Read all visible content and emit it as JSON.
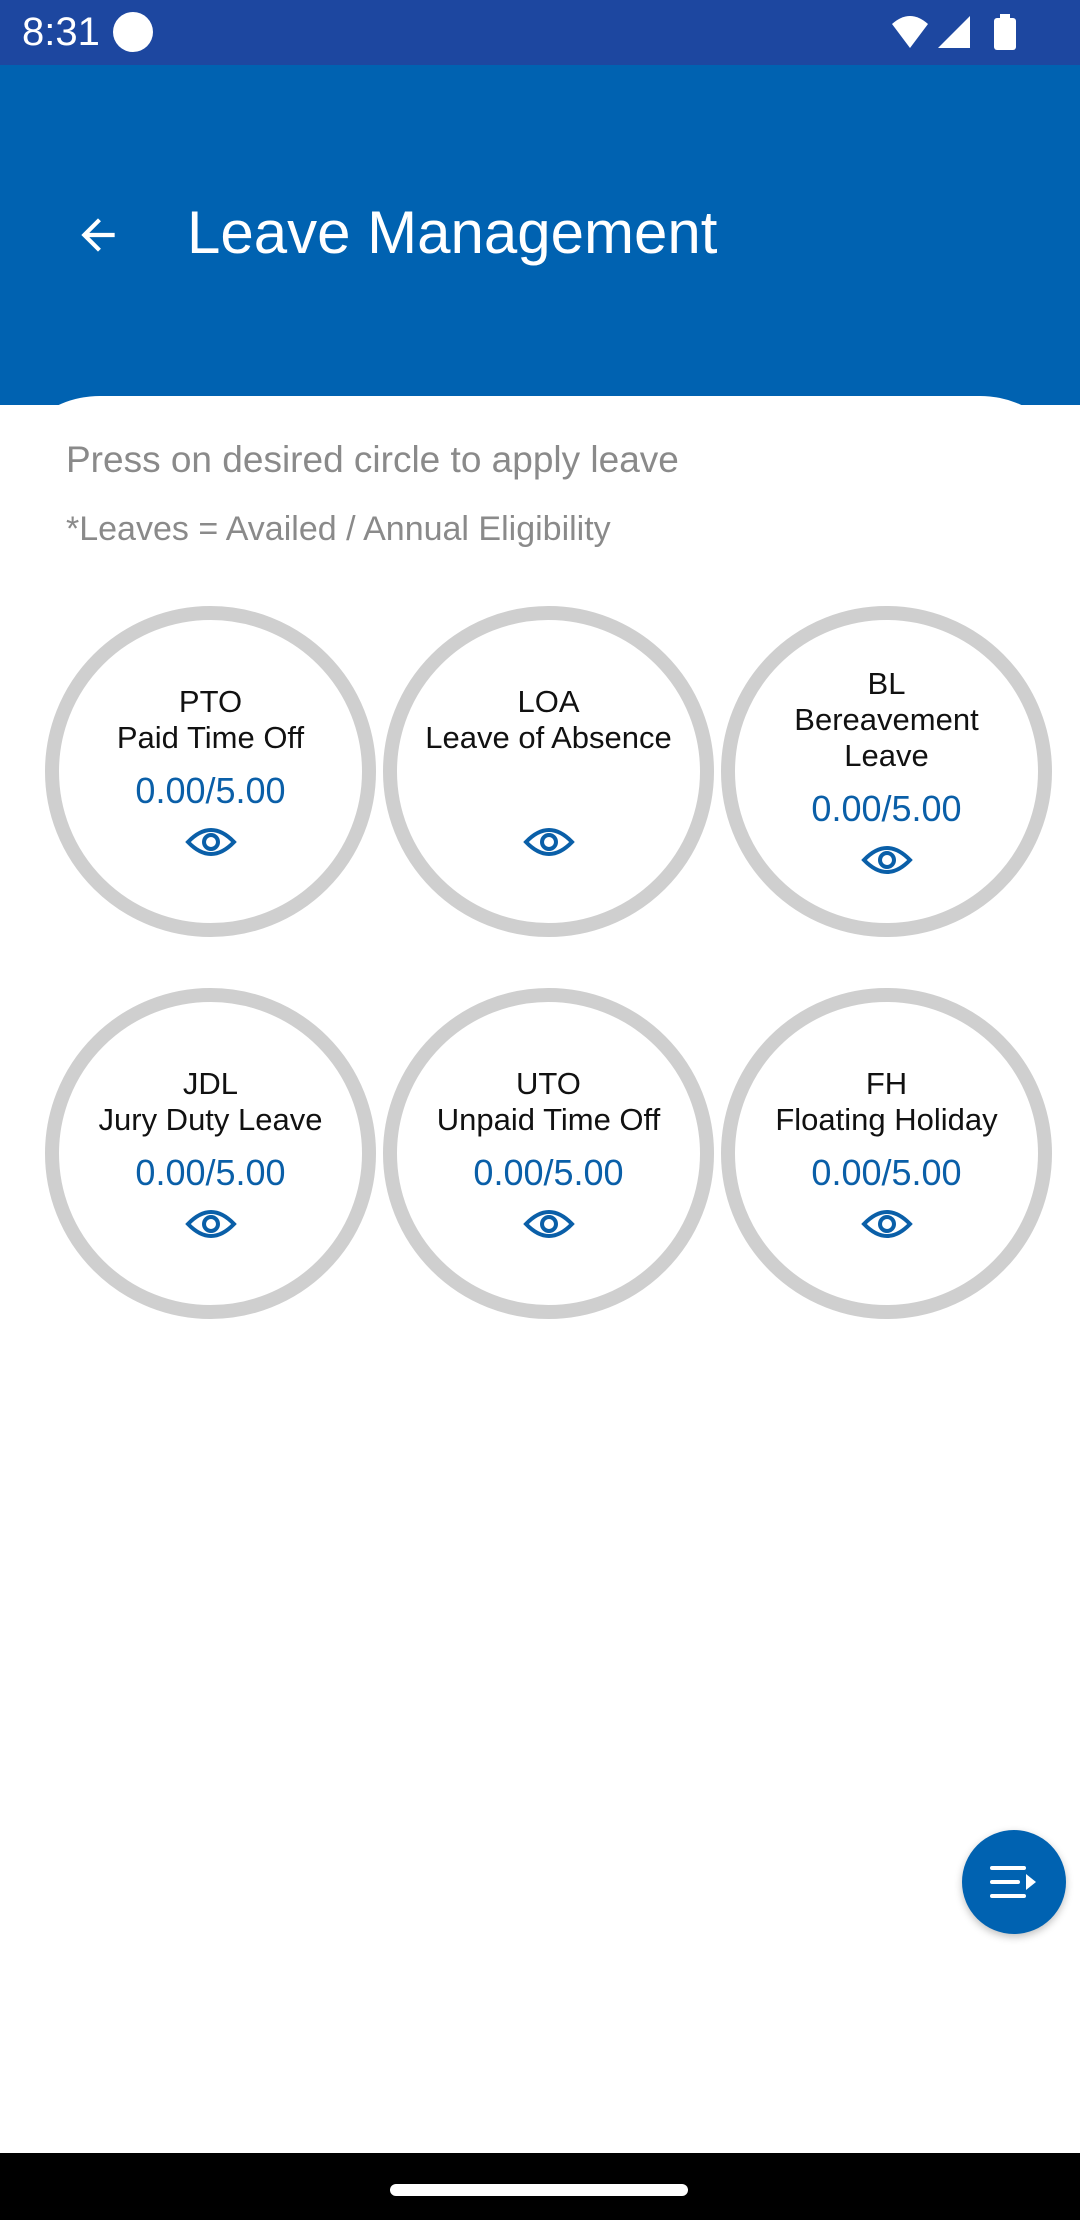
{
  "status_bar": {
    "time": "8:31",
    "icons": [
      "notification-dot-icon",
      "wifi-icon",
      "signal-icon",
      "battery-icon"
    ]
  },
  "header": {
    "title": "Leave Management",
    "back_icon": "arrow-left-icon"
  },
  "instructions": {
    "hint": "Press on desired circle to apply leave",
    "legend": "*Leaves = Availed / Annual Eligibility"
  },
  "leave_types": [
    {
      "code": "PTO",
      "name": "Paid Time Off",
      "value": "0.00/5.00"
    },
    {
      "code": "LOA",
      "name": "Leave of Absence",
      "value": ""
    },
    {
      "code": "BL",
      "name": "Bereavement Leave",
      "value": "0.00/5.00"
    },
    {
      "code": "JDL",
      "name": "Jury Duty Leave",
      "value": "0.00/5.00"
    },
    {
      "code": "UTO",
      "name": "Unpaid Time Off",
      "value": "0.00/5.00"
    },
    {
      "code": "FH",
      "name": "Floating Holiday",
      "value": "0.00/5.00"
    }
  ],
  "fab": {
    "icon": "menu-expand-icon"
  },
  "colors": {
    "status_bar": "#1d47a0",
    "app_bar": "#0062b1",
    "accent": "#0a5fa8",
    "circle_ring": "#cfcfcf",
    "muted_text": "#8a8a8a"
  }
}
